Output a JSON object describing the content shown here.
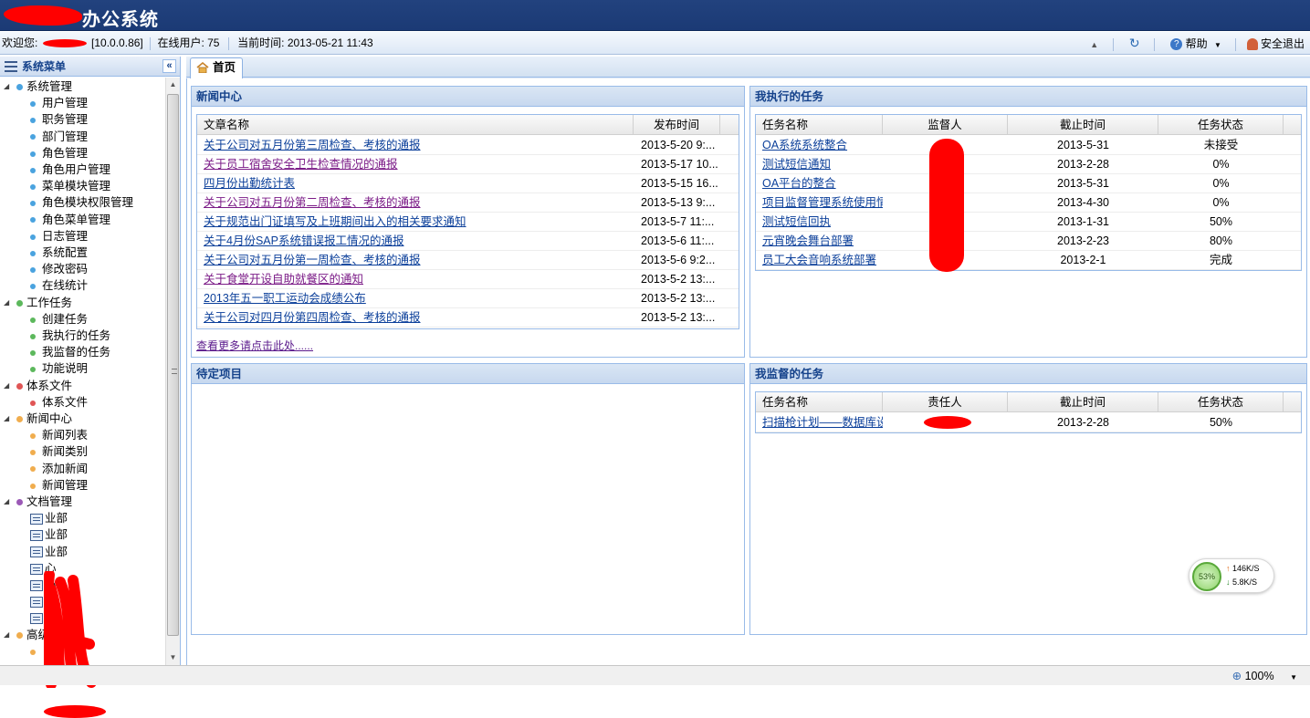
{
  "app": {
    "title": "办公系统"
  },
  "infobar": {
    "welcome": "欢迎您:",
    "ip": "[10.0.0.86]",
    "online": "在线用户: 75",
    "time": "当前时间: 2013-05-21 11:43",
    "help": "帮助",
    "logout": "安全退出"
  },
  "sidebar": {
    "title": "系统菜单",
    "groups": [
      {
        "label": "系统管理",
        "color": "#4aa3df",
        "items": [
          "用户管理",
          "职务管理",
          "部门管理",
          "角色管理",
          "角色用户管理",
          "菜单模块管理",
          "角色模块权限管理",
          "角色菜单管理",
          "日志管理",
          "系统配置",
          "修改密码",
          "在线统计"
        ]
      },
      {
        "label": "工作任务",
        "color": "#5cb85c",
        "items": [
          "创建任务",
          "我执行的任务",
          "我监督的任务",
          "功能说明"
        ]
      },
      {
        "label": "体系文件",
        "color": "#e05555",
        "items": [
          "体系文件"
        ]
      },
      {
        "label": "新闻中心",
        "color": "#f0ad4e",
        "items": [
          "新闻列表",
          "新闻类别",
          "添加新闻",
          "新闻管理"
        ]
      },
      {
        "label": "文档管理",
        "color": "#9b59b6",
        "items": [
          "业部",
          "业部",
          "业部",
          "心",
          "心",
          "心",
          ""
        ]
      },
      {
        "label": "高级事务",
        "color": "#f0ad4e",
        "items": [
          ""
        ]
      }
    ]
  },
  "tabs": [
    {
      "label": "首页"
    }
  ],
  "news": {
    "title": "新闻中心",
    "col_title": "文章名称",
    "col_date": "发布时间",
    "rows": [
      {
        "title": "关于公司对五月份第三周检查、考核的通报",
        "date": "2013-5-20 9:..."
      },
      {
        "title": "关于员工宿舍安全卫生检查情况的通报",
        "date": "2013-5-17 10..."
      },
      {
        "title": "四月份出勤统计表",
        "date": "2013-5-15 16..."
      },
      {
        "title": "关于公司对五月份第二周检查、考核的通报",
        "date": "2013-5-13 9:..."
      },
      {
        "title": "关于规范出门证填写及上班期间出入的相关要求通知",
        "date": "2013-5-7 11:..."
      },
      {
        "title": "关于4月份SAP系统错误报工情况的通报",
        "date": "2013-5-6 11:..."
      },
      {
        "title": "关于公司对五月份第一周检查、考核的通报",
        "date": "2013-5-6 9:2..."
      },
      {
        "title": "关于食堂开设自助就餐区的通知",
        "date": "2013-5-2 13:..."
      },
      {
        "title": "2013年五一职工运动会成绩公布",
        "date": "2013-5-2 13:..."
      },
      {
        "title": "关于公司对四月份第四周检查、考核的通报",
        "date": "2013-5-2 13:..."
      }
    ],
    "more": "查看更多请点击此处......"
  },
  "exec_tasks": {
    "title": "我执行的任务",
    "cols": [
      "任务名称",
      "监督人",
      "截止时间",
      "任务状态"
    ],
    "rows": [
      {
        "name": "OA系统系统整合",
        "deadline": "2013-5-31",
        "status": "未接受"
      },
      {
        "name": "测试短信通知",
        "deadline": "2013-2-28",
        "status": "0%"
      },
      {
        "name": "OA平台的整合",
        "deadline": "2013-5-31",
        "status": "0%"
      },
      {
        "name": "项目监督管理系统使用情",
        "deadline": "2013-4-30",
        "status": "0%"
      },
      {
        "name": "测试短信回执",
        "deadline": "2013-1-31",
        "status": "50%"
      },
      {
        "name": "元宵晚会舞台部署",
        "deadline": "2013-2-23",
        "status": "80%"
      },
      {
        "name": "员工大会音响系统部署",
        "deadline": "2013-2-1",
        "status": "完成"
      }
    ]
  },
  "pending": {
    "title": "待定项目"
  },
  "super_tasks": {
    "title": "我监督的任务",
    "cols": [
      "任务名称",
      "责任人",
      "截止时间",
      "任务状态"
    ],
    "rows": [
      {
        "name": "扫描枪计划——数据库设",
        "deadline": "2013-2-28",
        "status": "50%"
      }
    ]
  },
  "net": {
    "percent": "53%",
    "up": "146K/S",
    "down": "5.8K/S"
  },
  "status": {
    "zoom": "100%"
  },
  "colors": {
    "header": "#1f3f7a",
    "link": "#0b3f9a",
    "visited": "#7b1b87",
    "redaction": "#ff0000"
  }
}
